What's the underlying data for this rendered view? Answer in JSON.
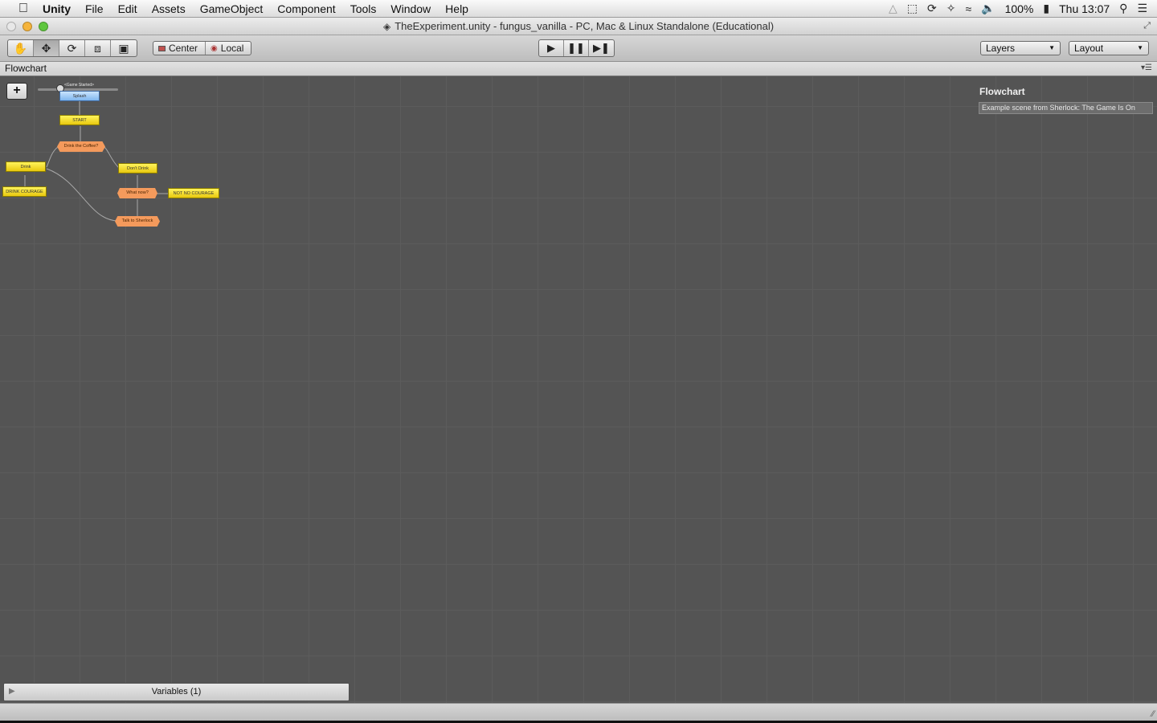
{
  "menubar": {
    "app_name": "Unity",
    "items": [
      "File",
      "Edit",
      "Assets",
      "GameObject",
      "Component",
      "Tools",
      "Window",
      "Help"
    ],
    "battery": "100%",
    "clock": "Thu 13:07"
  },
  "window": {
    "title": "TheExperiment.unity - fungus_vanilla - PC, Mac & Linux Standalone (Educational)"
  },
  "toolbar": {
    "pivot_center": "Center",
    "pivot_local": "Local",
    "layers": "Layers",
    "layout": "Layout"
  },
  "flowchart": {
    "tab_label": "Flowchart",
    "event_label": "<Game Started>",
    "nodes": [
      {
        "label": "Splash",
        "kind": "blue"
      },
      {
        "label": "START",
        "kind": "yellow"
      },
      {
        "label": "Drink the Coffee?",
        "kind": "orange"
      },
      {
        "label": "Drink",
        "kind": "yellow"
      },
      {
        "label": "DRINK COURAGE",
        "kind": "yellow"
      },
      {
        "label": "Don't Drink",
        "kind": "yellow"
      },
      {
        "label": "What now?",
        "kind": "orange"
      },
      {
        "label": "NOT NO COURAGE",
        "kind": "yellow"
      },
      {
        "label": "Talk to Sherlock",
        "kind": "orange"
      }
    ],
    "description_title": "Flowchart",
    "description": "Example scene from Sherlock: The Game Is On",
    "variables_label": "Variables (1)"
  }
}
